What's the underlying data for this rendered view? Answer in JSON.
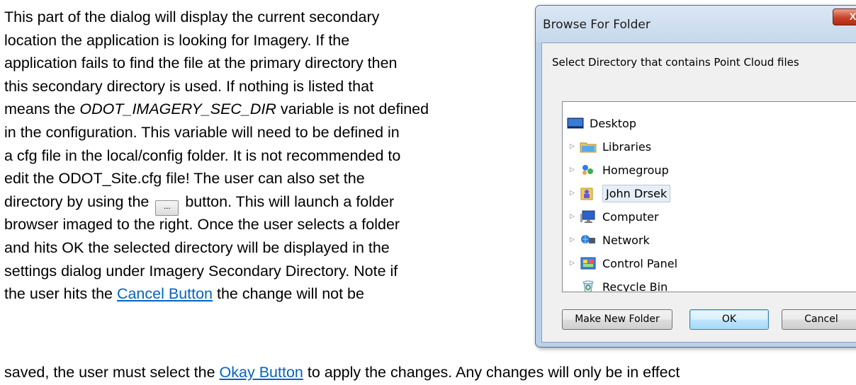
{
  "document": {
    "lines": [
      "This part of the dialog will display the current secondary",
      "location the application is looking for Imagery. If the",
      "application fails to find the file at the primary directory then",
      "this secondary directory is used. If nothing is listed that"
    ],
    "line5_pre": "means the ",
    "line5_em": "ODOT_IMAGERY_SEC_DIR",
    "line5_post": " variable is not defined",
    "lines_b": [
      "in the configuration. This variable will need to be defined in",
      "a cfg file in the local/config folder. It is not recommended to",
      "edit the ODOT_Site.cfg file! The user can also set the"
    ],
    "line9_pre": "directory by using the ",
    "inline_button_label": "...",
    "line9_post": " button. This will launch a folder",
    "lines_c": [
      "browser imaged to the right. Once the user selects a folder",
      "and hits OK the selected directory will be displayed in the",
      "settings dialog under Imagery Secondary Directory. Note if"
    ],
    "line13_pre": "the user hits the ",
    "cancel_link": "Cancel Button",
    "line13_post": "  the change will not be",
    "last_pre": "saved, the user must select the ",
    "okay_link": "Okay Button",
    "last_post": " to apply the changes. Any changes will only be in effect"
  },
  "dialog": {
    "title": "Browse For Folder",
    "close_label": "X",
    "instruction": "Select Directory that contains Point Cloud files",
    "tree": [
      {
        "label": "Desktop",
        "icon": "desktop-icon",
        "expander": ""
      },
      {
        "label": "Libraries",
        "icon": "libraries-icon",
        "expander": "▷"
      },
      {
        "label": "Homegroup",
        "icon": "homegroup-icon",
        "expander": "▷"
      },
      {
        "label": "John Drsek",
        "icon": "user-folder-icon",
        "expander": "▷"
      },
      {
        "label": "Computer",
        "icon": "computer-icon",
        "expander": "▷"
      },
      {
        "label": "Network",
        "icon": "network-icon",
        "expander": "▷"
      },
      {
        "label": "Control Panel",
        "icon": "control-panel-icon",
        "expander": "▷"
      },
      {
        "label": "Recycle Bin",
        "icon": "recycle-bin-icon",
        "expander": ""
      }
    ],
    "buttons": {
      "make_new_folder": "Make New Folder",
      "ok": "OK",
      "cancel": "Cancel"
    }
  }
}
